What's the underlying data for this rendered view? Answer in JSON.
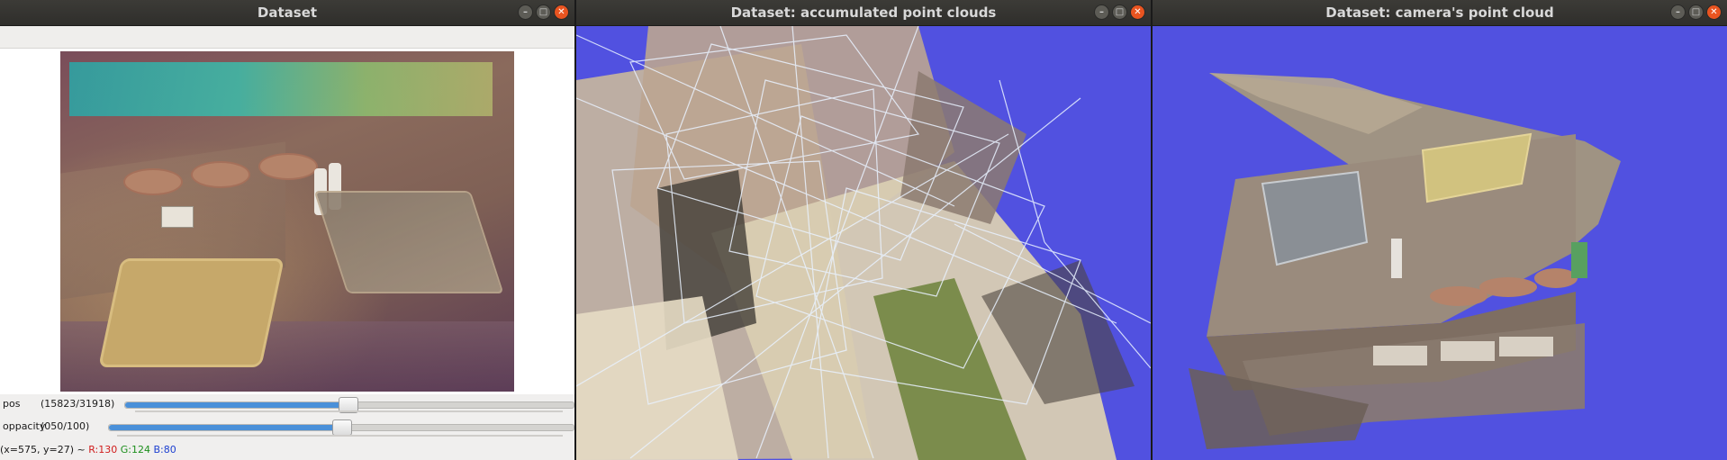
{
  "windows": {
    "dataset": {
      "title": "Dataset",
      "pos": {
        "label": "pos",
        "value_text": "(15823/31918)",
        "fraction": 0.4957
      },
      "opacity": {
        "label": "oppacity",
        "value_text": "(050/100)",
        "fraction": 0.5
      },
      "status": {
        "coords": "(x=575, y=27) ~",
        "r": "R:130",
        "g": "G:124",
        "b": "B:80"
      }
    },
    "accumulated": {
      "title": "Dataset: accumulated point clouds"
    },
    "camera": {
      "title": "Dataset: camera's point cloud"
    }
  },
  "window_buttons": {
    "minimize_icon": "minimize-icon",
    "maximize_icon": "maximize-icon",
    "close_icon": "close-icon"
  },
  "colors": {
    "view_background": "#5151e0",
    "slider_fill": "#4a90d9",
    "close_button": "#e95420"
  }
}
